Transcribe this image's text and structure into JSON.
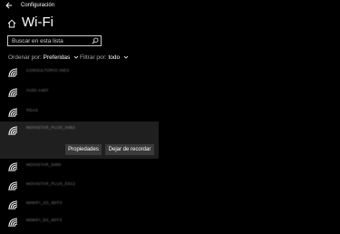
{
  "window": {
    "title": "Configuración",
    "back_glyph": "←"
  },
  "header": {
    "title": "Wi-Fi",
    "home_icon": "home-icon"
  },
  "search": {
    "placeholder": "Buscar en esta lista",
    "icon": "search-icon"
  },
  "filters": {
    "sort_label": "Ordenar por:",
    "sort_value": "Preferidas",
    "filter_label": "Filtrar por:",
    "filter_value": "todo"
  },
  "networks": [
    {
      "ssid": "CONSULTORIO INES"
    },
    {
      "ssid": "AUDI A4EF"
    },
    {
      "ssid": "PDAS"
    },
    {
      "ssid": "MOVISTAR_PLUS_04B2",
      "selected": true
    },
    {
      "ssid": "MOVISTAR_5480"
    },
    {
      "ssid": "MOVISTAR_PLUS_E912"
    },
    {
      "ssid": "MIWIFI_2G_8DT3"
    },
    {
      "ssid": "MIWIFI_5G_8DT3"
    }
  ],
  "selected_actions": {
    "properties_label": "Propiedades",
    "forget_label": "Dejar de recordar"
  },
  "colors": {
    "background": "#000000",
    "selected_row": "#1f1f1f",
    "button": "#3a3a3a"
  }
}
